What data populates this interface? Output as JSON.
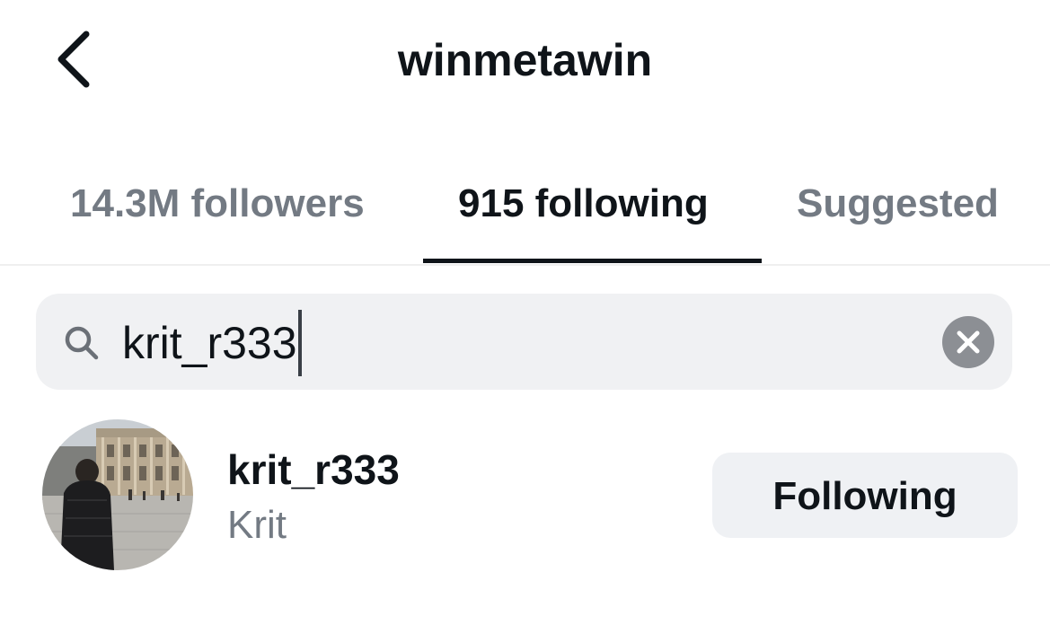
{
  "header": {
    "title": "winmetawin",
    "back_icon": "chevron-left-icon"
  },
  "tabs": [
    {
      "label": "14.3M followers",
      "active": false
    },
    {
      "label": "915 following",
      "active": true
    },
    {
      "label": "Suggested",
      "active": false
    }
  ],
  "search": {
    "icon": "search-icon",
    "value": "krit_r333",
    "clear_icon": "clear-icon"
  },
  "results": [
    {
      "username": "krit_r333",
      "display_name": "Krit",
      "button_label": "Following"
    }
  ],
  "colors": {
    "text_primary": "#0f1419",
    "text_secondary": "#737a83",
    "search_bg": "#f0f1f3",
    "button_bg": "#eff1f4",
    "clear_bg": "#8c8f94"
  }
}
